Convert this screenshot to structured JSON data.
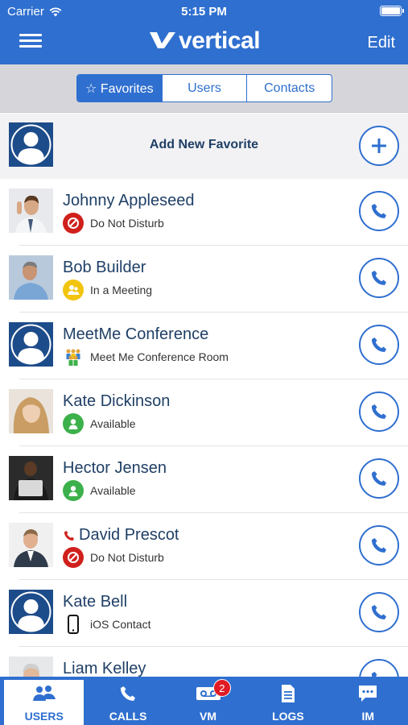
{
  "status_bar": {
    "carrier": "Carrier",
    "time": "5:15 PM"
  },
  "nav": {
    "logo_text": "vertical",
    "edit_label": "Edit",
    "menu_icon": "list-icon"
  },
  "segments": [
    {
      "label": "☆ Favorites",
      "active": true
    },
    {
      "label": "Users",
      "active": false
    },
    {
      "label": "Contacts",
      "active": false
    }
  ],
  "add_favorite": {
    "label": "Add New Favorite"
  },
  "contacts": [
    {
      "name": "Johnny Appleseed",
      "status": "Do Not Disturb",
      "status_icon": "do-not-disturb-icon",
      "avatar": "photo"
    },
    {
      "name": "Bob Builder",
      "status": "In a Meeting",
      "status_icon": "meeting-icon",
      "avatar": "photo"
    },
    {
      "name": "MeetMe Conference",
      "status": "Meet Me Conference Room",
      "status_icon": "conference-room-icon",
      "avatar": "placeholder"
    },
    {
      "name": "Kate Dickinson",
      "status": "Available",
      "status_icon": "available-icon",
      "avatar": "photo"
    },
    {
      "name": "Hector Jensen",
      "status": "Available",
      "status_icon": "available-icon",
      "avatar": "photo"
    },
    {
      "name": "David Prescot",
      "status": "Do Not Disturb",
      "status_icon": "do-not-disturb-icon",
      "avatar": "photo",
      "on_call": true
    },
    {
      "name": "Kate Bell",
      "status": "iOS Contact",
      "status_icon": "phone-device-icon",
      "avatar": "placeholder"
    },
    {
      "name": "Liam Kelley",
      "status": "",
      "status_icon": "",
      "avatar": "photo"
    }
  ],
  "tabs": [
    {
      "label": "USERS",
      "icon": "users-icon",
      "active": true
    },
    {
      "label": "CALLS",
      "icon": "phone-icon",
      "active": false
    },
    {
      "label": "VM",
      "icon": "voicemail-icon",
      "active": false,
      "badge": "2"
    },
    {
      "label": "LOGS",
      "icon": "document-icon",
      "active": false
    },
    {
      "label": "IM",
      "icon": "chat-icon",
      "active": false
    }
  ],
  "colors": {
    "brand_blue": "#2f6fcf",
    "dnd_red": "#d0201c",
    "meeting_yellow": "#f2c40f",
    "available_green": "#3cb04a",
    "name_navy": "#1f3f66"
  }
}
